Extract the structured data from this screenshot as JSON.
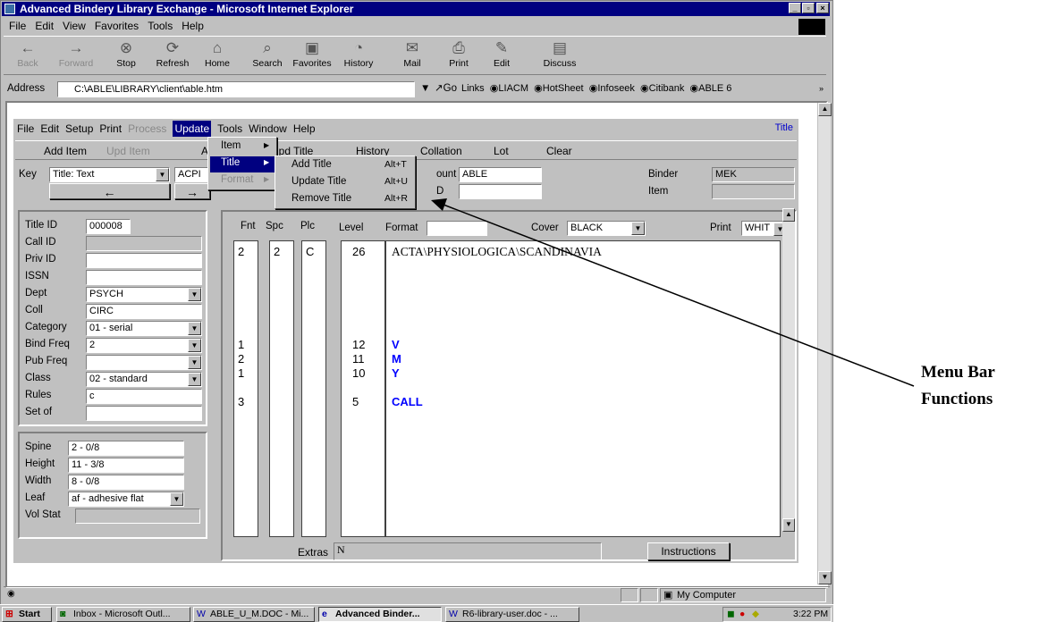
{
  "window": {
    "title": "Advanced Bindery Library Exchange - Microsoft Internet Explorer"
  },
  "ie_menu": [
    "File",
    "Edit",
    "View",
    "Favorites",
    "Tools",
    "Help"
  ],
  "toolbar": [
    {
      "label": "Back",
      "icon": "back-arrow-icon",
      "disabled": true
    },
    {
      "label": "Forward",
      "icon": "forward-arrow-icon",
      "disabled": true
    },
    {
      "label": "Stop",
      "icon": "stop-icon"
    },
    {
      "label": "Refresh",
      "icon": "refresh-icon"
    },
    {
      "label": "Home",
      "icon": "home-icon"
    },
    {
      "label": "Search",
      "icon": "search-icon"
    },
    {
      "label": "Favorites",
      "icon": "favorites-icon"
    },
    {
      "label": "History",
      "icon": "history-icon"
    },
    {
      "label": "Mail",
      "icon": "mail-icon"
    },
    {
      "label": "Print",
      "icon": "print-icon"
    },
    {
      "label": "Edit",
      "icon": "edit-icon"
    },
    {
      "label": "Discuss",
      "icon": "discuss-icon"
    }
  ],
  "address": {
    "label": "Address",
    "value": "C:\\ABLE\\LIBRARY\\client\\able.htm",
    "go": "Go",
    "links_label": "Links",
    "links": [
      "LIACM",
      "HotSheet",
      "Infoseek",
      "Citibank",
      "ABLE 6"
    ]
  },
  "app": {
    "menu": [
      "File",
      "Edit",
      "Setup",
      "Print",
      "Process",
      "Update",
      "Tools",
      "Window",
      "Help"
    ],
    "title_link": "Title",
    "buttons": [
      "Add Item",
      "Upd Item",
      "A",
      "Upd Title",
      "History",
      "Collation",
      "Lot",
      "Clear"
    ],
    "key_label": "Key",
    "key_value": "Title: Text",
    "key_value2": "ACPI",
    "account_label": "ount",
    "account_value": "ABLE",
    "id_label": "D",
    "binder_label": "Binder",
    "binder_value": "MEK",
    "item_label": "Item",
    "fields": [
      {
        "label": "Title ID",
        "value": "000008"
      },
      {
        "label": "Call ID",
        "value": ""
      },
      {
        "label": "Priv ID",
        "value": ""
      },
      {
        "label": "ISSN",
        "value": ""
      },
      {
        "label": "Dept",
        "value": "PSYCH"
      },
      {
        "label": "Coll",
        "value": "CIRC"
      },
      {
        "label": "Category",
        "value": "01 - serial"
      },
      {
        "label": "Bind Freq",
        "value": "2"
      },
      {
        "label": "Pub Freq",
        "value": ""
      },
      {
        "label": "Class",
        "value": "02 - standard"
      },
      {
        "label": "Rules",
        "value": "c"
      },
      {
        "label": "Set of",
        "value": ""
      }
    ],
    "dims": [
      {
        "label": "Spine",
        "value": "2 - 0/8"
      },
      {
        "label": "Height",
        "value": "11 - 3/8"
      },
      {
        "label": "Width",
        "value": "8 - 0/8"
      },
      {
        "label": "Leaf",
        "value": "af - adhesive flat"
      },
      {
        "label": "Vol Stat",
        "value": ""
      }
    ],
    "grid_headers": {
      "fnt": "Fnt",
      "spc": "Spc",
      "plc": "Plc",
      "level": "Level",
      "format": "Format",
      "cover": "Cover",
      "cover_value": "BLACK",
      "print": "Print",
      "print_value": "WHIT"
    },
    "rows": [
      {
        "fnt": "2",
        "spc": "2",
        "plc": "C",
        "level": "26",
        "text": "ACTA\\PHYSIOLOGICA\\SCANDINAVIA",
        "blue": false
      },
      {
        "fnt": "1",
        "spc": "",
        "plc": "",
        "level": "12",
        "text": "V",
        "blue": true
      },
      {
        "fnt": "2",
        "spc": "",
        "plc": "",
        "level": "11",
        "text": "M",
        "blue": true
      },
      {
        "fnt": "1",
        "spc": "",
        "plc": "",
        "level": "10",
        "text": "Y",
        "blue": true
      },
      {
        "fnt": "3",
        "spc": "",
        "plc": "",
        "level": "5",
        "text": "CALL",
        "blue": true
      }
    ],
    "extras_label": "Extras",
    "extras_value": "N",
    "instructions": "Instructions"
  },
  "update_menu": [
    "Item",
    "Title",
    "Format"
  ],
  "title_submenu": [
    {
      "label": "Add Title",
      "shortcut": "Alt+T"
    },
    {
      "label": "Update Title",
      "shortcut": "Alt+U"
    },
    {
      "label": "Remove Title",
      "shortcut": "Alt+R"
    }
  ],
  "status": {
    "zone": "My Computer"
  },
  "taskbar": {
    "start": "Start",
    "tasks": [
      "Inbox - Microsoft Outl...",
      "ABLE_U_M.DOC - Mi...",
      "Advanced Binder...",
      "R6-library-user.doc - ..."
    ],
    "time": "3:22 PM"
  },
  "annotation": {
    "line1": "Menu Bar",
    "line2": "Functions"
  }
}
